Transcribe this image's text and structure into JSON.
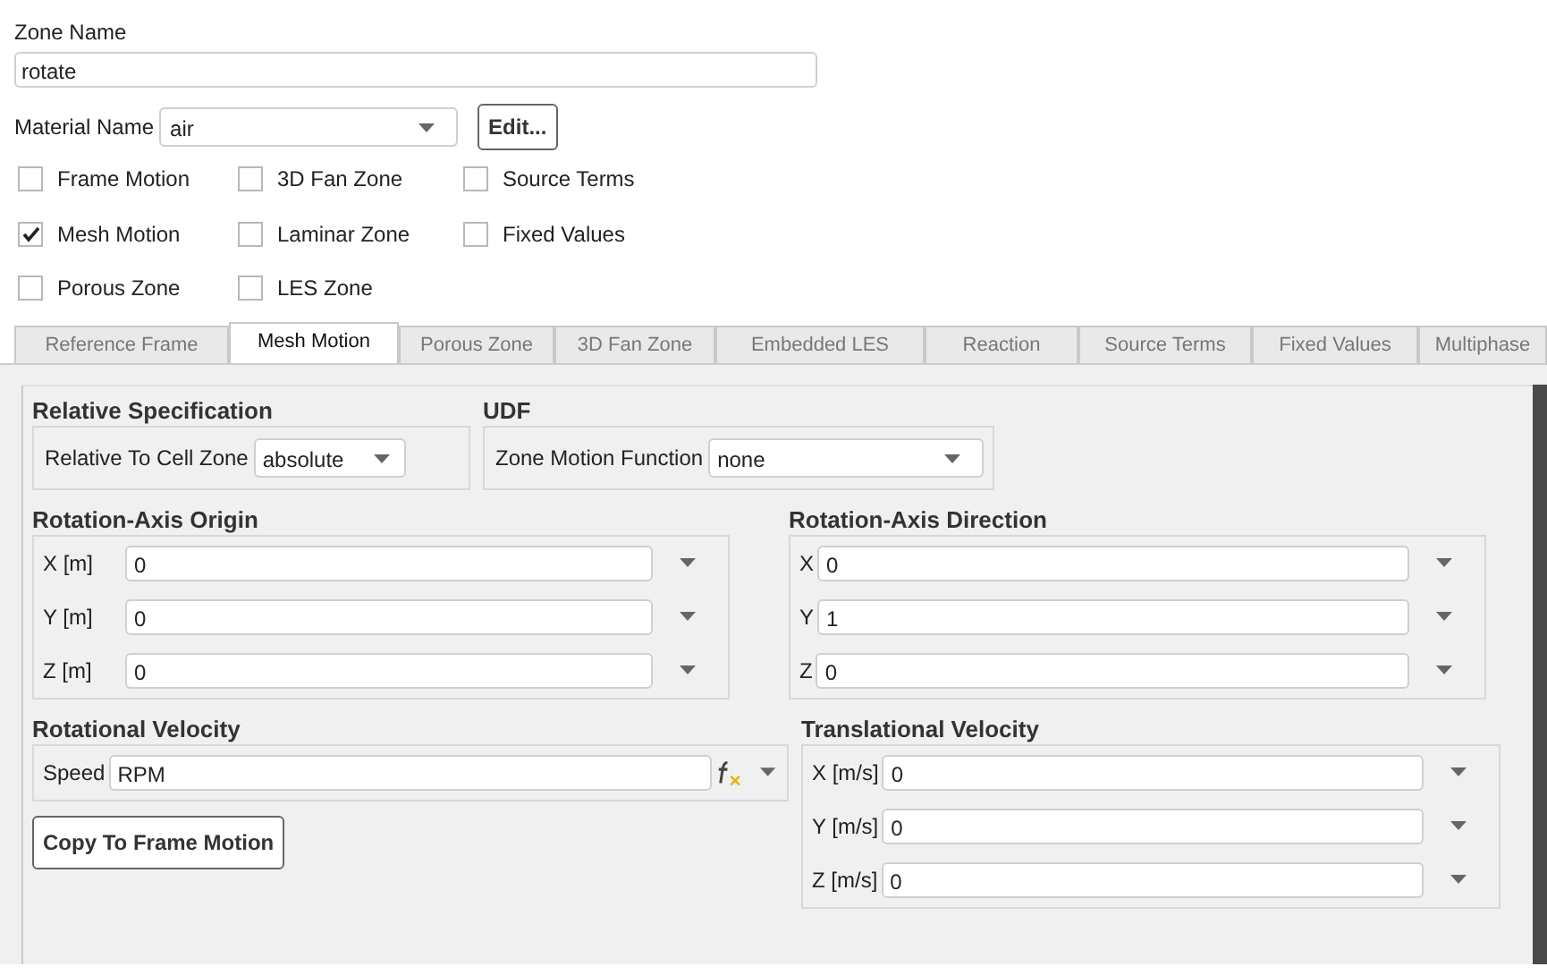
{
  "zone_name": {
    "label": "Zone Name",
    "value": "rotate"
  },
  "material": {
    "label": "Material Name",
    "value": "air"
  },
  "edit_button": "Edit...",
  "options": [
    {
      "label": "Frame Motion",
      "checked": false
    },
    {
      "label": "3D Fan Zone",
      "checked": false
    },
    {
      "label": "Source Terms",
      "checked": false
    },
    {
      "label": "Mesh Motion",
      "checked": true
    },
    {
      "label": "Laminar Zone",
      "checked": false
    },
    {
      "label": "Fixed Values",
      "checked": false
    },
    {
      "label": "Porous Zone",
      "checked": false
    },
    {
      "label": "LES Zone",
      "checked": false
    }
  ],
  "tabs": [
    {
      "label": "Reference Frame",
      "selected": false
    },
    {
      "label": "Mesh Motion",
      "selected": true
    },
    {
      "label": "Porous Zone",
      "selected": false
    },
    {
      "label": "3D Fan Zone",
      "selected": false
    },
    {
      "label": "Embedded LES",
      "selected": false
    },
    {
      "label": "Reaction",
      "selected": false
    },
    {
      "label": "Source Terms",
      "selected": false
    },
    {
      "label": "Fixed Values",
      "selected": false
    },
    {
      "label": "Multiphase",
      "selected": false
    }
  ],
  "relative_specification": {
    "title": "Relative Specification",
    "label": "Relative To Cell Zone",
    "value": "absolute"
  },
  "udf": {
    "title": "UDF",
    "label": "Zone Motion Function",
    "value": "none"
  },
  "rotation_axis_origin": {
    "title": "Rotation-Axis Origin",
    "fields": [
      {
        "label": "X [m]",
        "value": "0"
      },
      {
        "label": "Y [m]",
        "value": "0"
      },
      {
        "label": "Z [m]",
        "value": "0"
      }
    ]
  },
  "rotation_axis_direction": {
    "title": "Rotation-Axis Direction",
    "fields": [
      {
        "label": "X",
        "value": "0"
      },
      {
        "label": "Y",
        "value": "1"
      },
      {
        "label": "Z",
        "value": "0"
      }
    ]
  },
  "rotational_velocity": {
    "title": "Rotational Velocity",
    "fields": [
      {
        "label": "Speed",
        "value": "RPM",
        "expression": true
      }
    ]
  },
  "translational_velocity": {
    "title": "Translational Velocity",
    "fields": [
      {
        "label": "X [m/s]",
        "value": "0"
      },
      {
        "label": "Y [m/s]",
        "value": "0"
      },
      {
        "label": "Z [m/s]",
        "value": "0"
      }
    ]
  },
  "copy_button": "Copy To Frame Motion"
}
